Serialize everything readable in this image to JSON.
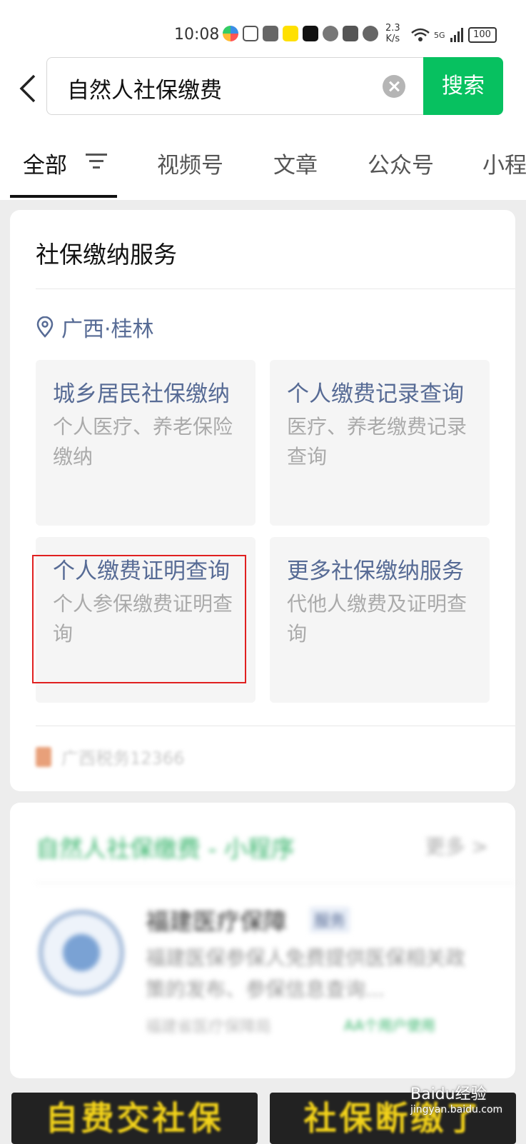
{
  "status_bar": {
    "time": "10:08",
    "speed_top": "2.3",
    "speed_bottom": "K/s",
    "signal": "5G",
    "battery": "100"
  },
  "search": {
    "query": "自然人社保缴费",
    "button_label": "搜索"
  },
  "tabs": [
    "全部",
    "视频号",
    "文章",
    "公众号",
    "小程"
  ],
  "service_card": {
    "title": "社保缴纳服务",
    "location": "广西·桂林",
    "tiles": [
      {
        "title": "城乡居民社保缴纳",
        "desc": "个人医疗、养老保险缴纳"
      },
      {
        "title": "个人缴费记录查询",
        "desc": "医疗、养老缴费记录查询"
      },
      {
        "title": "个人缴费证明查询",
        "desc": "个人参保缴费证明查询"
      },
      {
        "title": "更多社保缴纳服务",
        "desc": "代他人缴费及证明查询"
      }
    ],
    "source": "广西税务12366"
  },
  "mini_program_card": {
    "title": "自然人社保缴费 - 小程序",
    "more": "更多 >",
    "item_name": "福建医疗保障",
    "item_tag": "服务",
    "item_desc": "福建医保参保人免费提供医保相关政策的发布、参保信息查询...",
    "item_footer": "福建省医疗保障局",
    "item_footer_extra": "AA个用户使用"
  },
  "banners": [
    "自费交社保",
    "社保断缴了"
  ],
  "watermark": {
    "brand": "Baidu经验",
    "url": "jingyan.baidu.com"
  },
  "colors": {
    "accent": "#07c160",
    "link": "#576b95",
    "highlight": "#e02020"
  }
}
